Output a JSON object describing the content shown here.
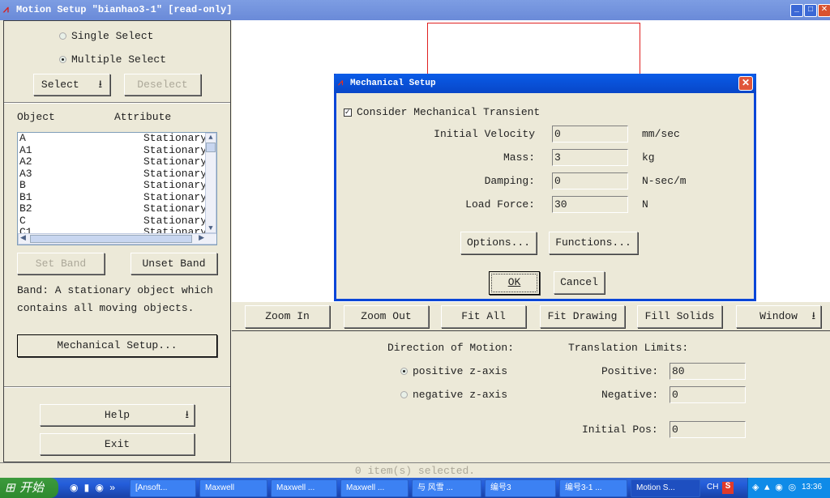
{
  "window": {
    "title": "Motion Setup \"bianhao3-1\" [read-only]"
  },
  "left": {
    "single_select": "Single Select",
    "multiple_select": "Multiple Select",
    "selected_mode": "Multiple Select",
    "select_btn": "Select",
    "deselect_btn": "Deselect",
    "col_object": "Object",
    "col_attribute": "Attribute",
    "rows": [
      {
        "o": "A",
        "a": "Stationary"
      },
      {
        "o": "A1",
        "a": "Stationary"
      },
      {
        "o": "A2",
        "a": "Stationary"
      },
      {
        "o": "A3",
        "a": "Stationary"
      },
      {
        "o": "B",
        "a": "Stationary"
      },
      {
        "o": "B1",
        "a": "Stationary"
      },
      {
        "o": "B2",
        "a": "Stationary"
      },
      {
        "o": "C",
        "a": "Stationary"
      },
      {
        "o": "C1",
        "a": "Stationary"
      }
    ],
    "set_band": "Set Band",
    "unset_band": "Unset Band",
    "band_desc": "Band: A stationary object which contains all moving objects.",
    "mech_setup": "Mechanical Setup...",
    "help": "Help",
    "exit": "Exit"
  },
  "toolbar": {
    "zoom_in": "Zoom In",
    "zoom_out": "Zoom Out",
    "fit_all": "Fit All",
    "fit_drawing": "Fit Drawing",
    "fill_solids": "Fill Solids",
    "window": "Window"
  },
  "motion": {
    "direction_label": "Direction of Motion:",
    "positive": "positive z-axis",
    "negative": "negative z-axis",
    "selected": "positive z-axis",
    "limits_label": "Translation Limits:",
    "pos_label": "Positive:",
    "pos_value": "80",
    "neg_label": "Negative:",
    "neg_value": "0",
    "init_label": "Initial Pos:",
    "init_value": "0"
  },
  "status": "0 item(s) selected.",
  "dialog": {
    "title": "Mechanical Setup",
    "transient_label": "Consider Mechanical Transient",
    "transient_checked": true,
    "fields": [
      {
        "label": "Initial Velocity",
        "value": "0",
        "unit": "mm/sec"
      },
      {
        "label": "Mass:",
        "value": "3",
        "unit": "kg"
      },
      {
        "label": "Damping:",
        "value": "0",
        "unit": "N-sec/m"
      },
      {
        "label": "Load Force:",
        "value": "30",
        "unit": "N"
      }
    ],
    "options": "Options...",
    "functions": "Functions...",
    "ok": "OK",
    "cancel": "Cancel"
  },
  "taskbar": {
    "start": "开始",
    "items": [
      "[Ansoft...",
      "Maxwell",
      "Maxwell ...",
      "Maxwell ...",
      "与 风雪 ...",
      "编号3",
      "编号3-1 ...",
      "Motion S..."
    ],
    "lang": "CH",
    "clock": "13:36"
  }
}
